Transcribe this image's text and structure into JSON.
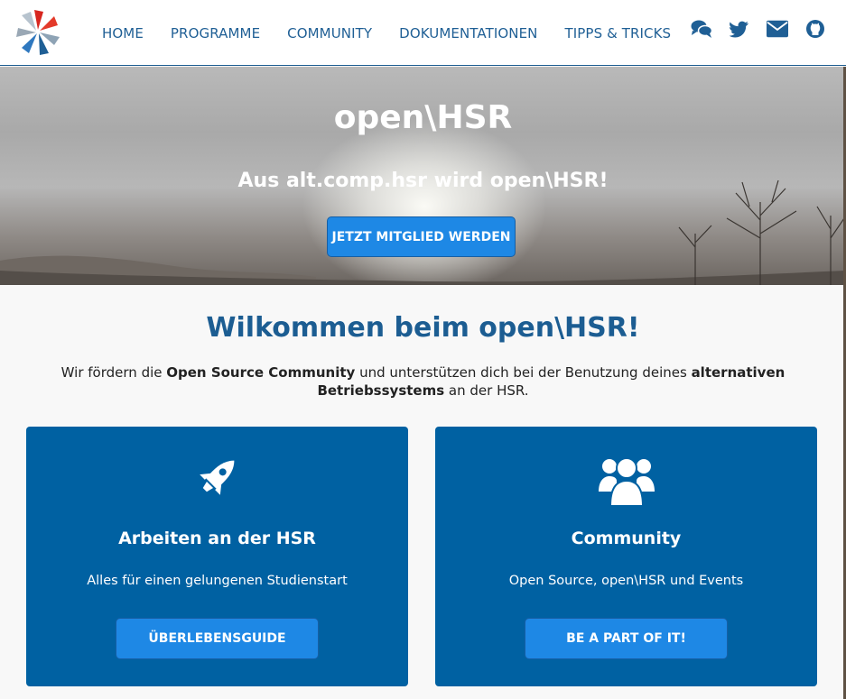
{
  "nav": {
    "links": [
      "HOME",
      "PROGRAMME",
      "COMMUNITY",
      "DOKUMENTATIONEN",
      "TIPPS & TRICKS"
    ],
    "icons": [
      "chat-icon",
      "twitter-icon",
      "mail-icon",
      "github-icon"
    ]
  },
  "hero": {
    "title": "open\\HSR",
    "subtitle": "Aus alt.comp.hsr wird open\\HSR!",
    "cta": "JETZT MITGLIED WERDEN"
  },
  "welcome": {
    "title": "Wilkommen beim open\\HSR!",
    "text_1": "Wir fördern die ",
    "bold_1": "Open Source Community",
    "text_2": " und unterstützen dich bei der Benutzung deines ",
    "bold_2": "alternativen Betriebssystems",
    "text_3": " an der HSR."
  },
  "cards": [
    {
      "icon": "rocket-icon",
      "title": "Arbeiten an der HSR",
      "text": "Alles für einen gelungenen Studienstart",
      "button": "ÜBERLEBENSGUIDE"
    },
    {
      "icon": "users-icon",
      "title": "Community",
      "text": "Open Source, open\\HSR und Events",
      "button": "BE A PART OF IT!"
    }
  ],
  "colors": {
    "brand_blue": "#1f5f95",
    "card_blue": "#0061a2",
    "button_blue": "#1e88e5"
  }
}
